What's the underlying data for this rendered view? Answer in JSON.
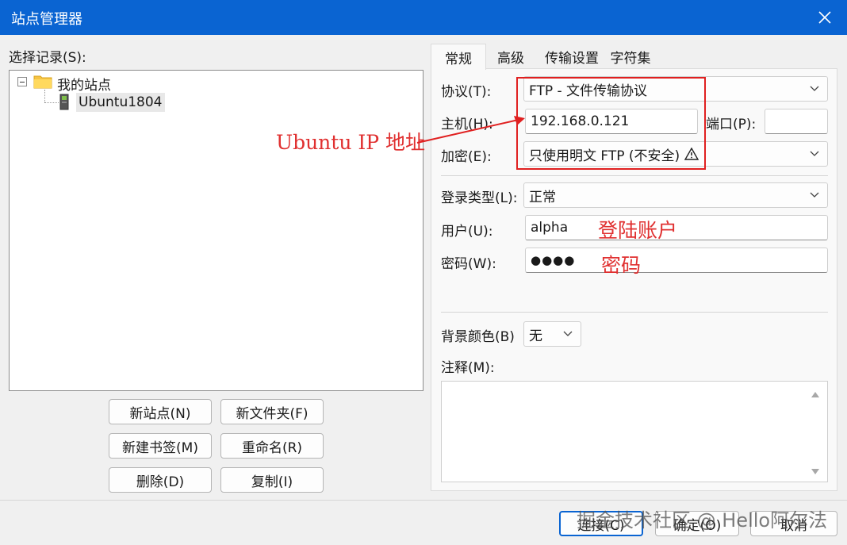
{
  "window": {
    "title": "站点管理器"
  },
  "left": {
    "records_label": "选择记录(S):",
    "tree": {
      "root_label": "我的站点",
      "child_label": "Ubuntu1804"
    },
    "buttons": {
      "new_site": "新站点(N)",
      "new_folder": "新文件夹(F)",
      "new_bookmark": "新建书签(M)",
      "rename": "重命名(R)",
      "delete": "删除(D)",
      "copy": "复制(I)"
    }
  },
  "tabs": [
    "常规",
    "高级",
    "传输设置",
    "字符集"
  ],
  "form": {
    "protocol_label": "协议(T):",
    "protocol_value": "FTP - 文件传输协议",
    "host_label": "主机(H):",
    "host_value": "192.168.0.121",
    "port_label": "端口(P):",
    "port_value": "",
    "encryption_label": "加密(E):",
    "encryption_value": "只使用明文 FTP (不安全)",
    "logon_type_label": "登录类型(L):",
    "logon_type_value": "正常",
    "user_label": "用户(U):",
    "user_value": "alpha",
    "password_label": "密码(W):",
    "password_value": "●●●●",
    "bg_color_label": "背景颜色(B)",
    "bg_color_value": "无",
    "comments_label": "注释(M):",
    "comments_value": ""
  },
  "annotations": {
    "ip": "Ubuntu IP 地址",
    "account": "登陆账户",
    "password": "密码"
  },
  "footer": {
    "connect": "连接(C)",
    "ok": "确定(O)",
    "cancel": "取消",
    "watermark": "掘金技术社区 @ Hello阿尔法"
  },
  "colors": {
    "titlebar": "#0a64d2",
    "annotation": "#e03030"
  }
}
